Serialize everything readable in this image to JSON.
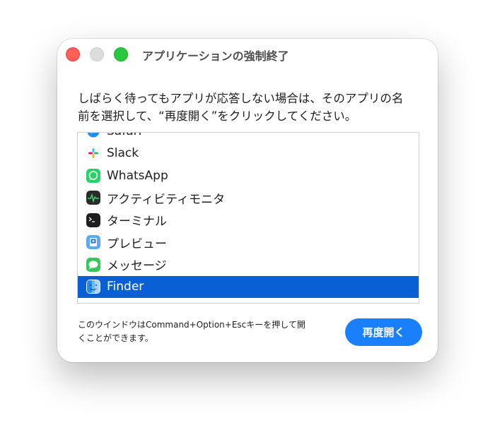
{
  "window": {
    "title": "アプリケーションの強制終了"
  },
  "instructions": {
    "line1": "しばらく待ってもアプリが応答しない場合は、そのアプリの名",
    "line2": "前を選択して、“再度開く”をクリックしてください。"
  },
  "apps": [
    {
      "name": "Safari",
      "icon": "safari-icon"
    },
    {
      "name": "Slack",
      "icon": "slack-icon"
    },
    {
      "name": "WhatsApp",
      "icon": "whatsapp-icon"
    },
    {
      "name": "アクティビティモニタ",
      "icon": "activity-monitor-icon"
    },
    {
      "name": "ターミナル",
      "icon": "terminal-icon"
    },
    {
      "name": "プレビュー",
      "icon": "preview-icon"
    },
    {
      "name": "メッセージ",
      "icon": "messages-icon"
    },
    {
      "name": "Finder",
      "icon": "finder-icon",
      "selected": true
    }
  ],
  "footer": {
    "note_line1": "このウインドウはCommand+Option+Escキーを押して開",
    "note_line2": "くことができます。",
    "button_label": "再度開く"
  },
  "colors": {
    "selection": "#0960d5",
    "button": "#1a7ffb",
    "close": "#ff5f57",
    "zoom": "#28c840"
  }
}
